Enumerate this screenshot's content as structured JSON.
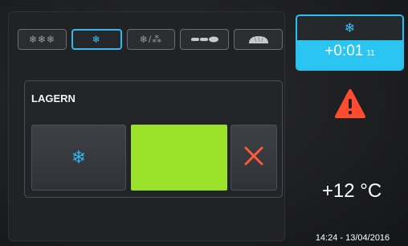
{
  "mode_tabs": [
    {
      "icon": "triple-snowflake-icon",
      "label": "❄❄❄",
      "active": false
    },
    {
      "icon": "snowflake-icon",
      "label": "❄",
      "active": true
    },
    {
      "icon": "snowflake-proofing-icon",
      "label": "❄/⁂",
      "active": false
    },
    {
      "icon": "baguette-icon",
      "label": "",
      "active": false
    },
    {
      "icon": "bread-loaf-icon",
      "label": "",
      "active": false
    }
  ],
  "store": {
    "title": "LAGERN",
    "snow_button_glyph": "❄",
    "status_color": "#9be22a"
  },
  "timer": {
    "mode_glyph": "❄",
    "value": "+0:01",
    "seconds": "11"
  },
  "status": {
    "temperature": "+12 °C",
    "datetime": "14:24 - 13/04/2016"
  },
  "colors": {
    "accent": "#2cc0f0",
    "warning": "#ff4c2e",
    "cancel": "#ff5a3a"
  }
}
